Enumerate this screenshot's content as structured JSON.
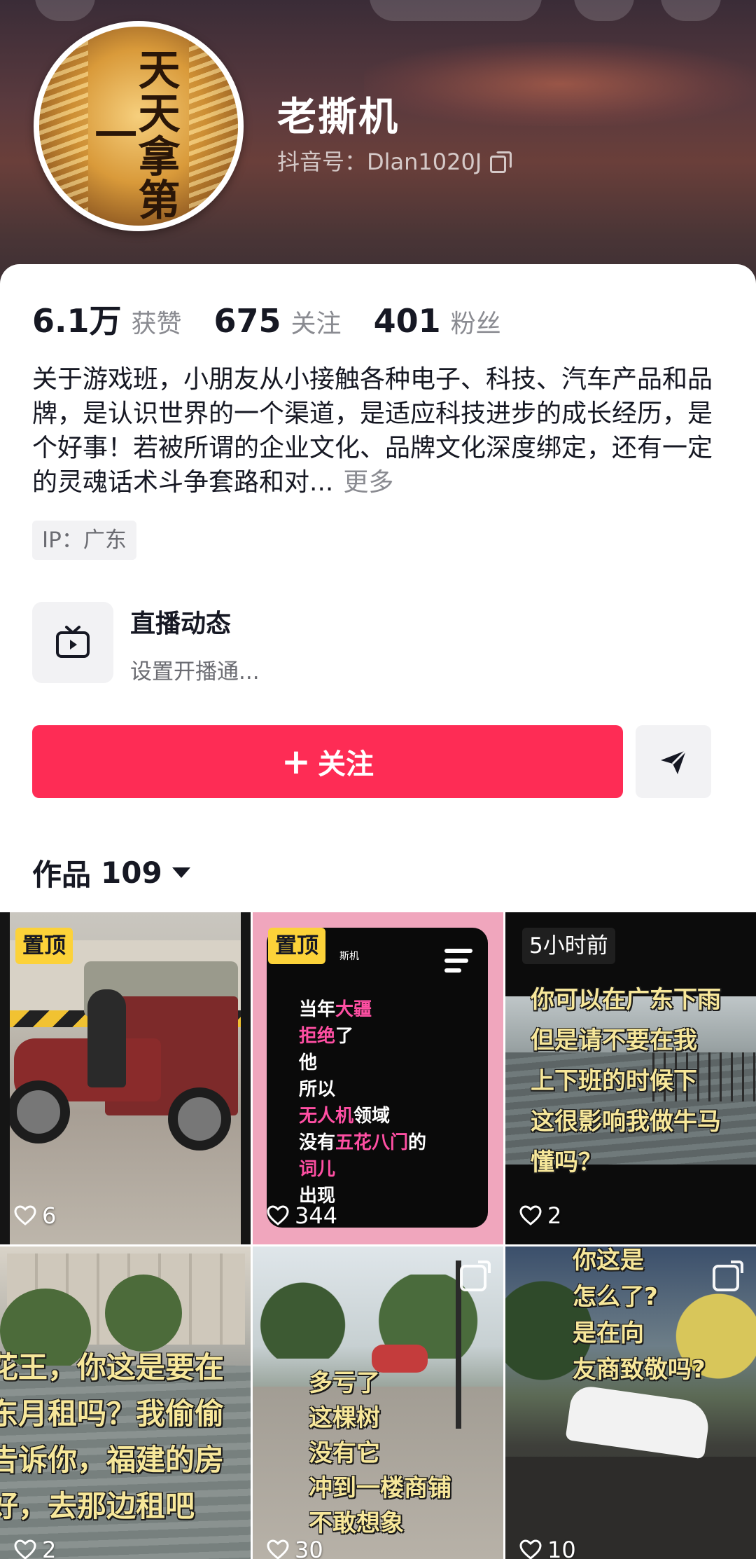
{
  "profile": {
    "nickname": "老撕机",
    "douyin_id": "抖音号：Dlan1020J",
    "avatar_text": "天天拿第一"
  },
  "stats": {
    "likes_num": "6.1万",
    "likes_label": "获赞",
    "following_num": "675",
    "following_label": "关注",
    "followers_num": "401",
    "followers_label": "粉丝"
  },
  "bio": {
    "text": "关于游戏班，小朋友从小接触各种电子、科技、汽车产品和品牌，是认识世界的一个渠道，是适应科技进步的成长经历，是个好事！若被所谓的企业文化、品牌文化深度绑定，还有一定的灵魂话术斗争套路和对...",
    "more": "更多"
  },
  "ip": "IP：广东",
  "live": {
    "title": "直播动态",
    "subtitle": "设置开播通..."
  },
  "actions": {
    "follow_plus": "+",
    "follow_label": "关注"
  },
  "works": {
    "label": "作品",
    "count": "109"
  },
  "videos": [
    {
      "badge": "置顶",
      "likes": "6"
    },
    {
      "badge": "置顶",
      "likes": "344",
      "tiny_text": "斯机",
      "lyrics": [
        [
          {
            "t": "当年",
            "c": "w"
          },
          {
            "t": "大疆",
            "c": "p"
          }
        ],
        [
          {
            "t": "拒绝",
            "c": "p"
          },
          {
            "t": "了",
            "c": "w"
          }
        ],
        [
          {
            "t": "他",
            "c": "w"
          }
        ],
        [
          {
            "t": "所以",
            "c": "w"
          }
        ],
        [
          {
            "t": "无人机",
            "c": "p"
          },
          {
            "t": "领域",
            "c": "w"
          }
        ],
        [
          {
            "t": "没有",
            "c": "w"
          },
          {
            "t": "五花八门",
            "c": "p"
          },
          {
            "t": "的",
            "c": "w"
          }
        ],
        [
          {
            "t": "词儿",
            "c": "p"
          }
        ],
        [
          {
            "t": "出现",
            "c": "w"
          }
        ]
      ]
    },
    {
      "badge": "5小时前",
      "likes": "2",
      "overlay": [
        "你可以在广东下雨",
        "但是请不要在我",
        "上下班的时候下",
        "这很影响我做牛马",
        "懂吗？"
      ]
    },
    {
      "likes": "2",
      "overlay": [
        "花王，你这是要在",
        "东月租吗？我偷偷",
        "告诉你，福建的房",
        "好，去那边租吧"
      ]
    },
    {
      "likes": "30",
      "overlay": [
        "多亏了",
        "这棵树",
        "没有它",
        "冲到一楼商铺",
        "不敢想象"
      ]
    },
    {
      "likes": "10",
      "overlay": [
        "你这是",
        "怎么了?",
        "是在向",
        "友商致敬吗?"
      ]
    }
  ],
  "colors": {
    "follow_button": "#fe2c55",
    "pin_badge": "#fcd239",
    "overlay_text": "#f7e79a",
    "lyric_pink": "#ff4fa3"
  },
  "icons": {
    "live": "tv-icon",
    "share": "send-arrow-icon",
    "copy": "copy-icon",
    "like": "heart-outline-icon",
    "dropdown": "caret-down-icon"
  }
}
